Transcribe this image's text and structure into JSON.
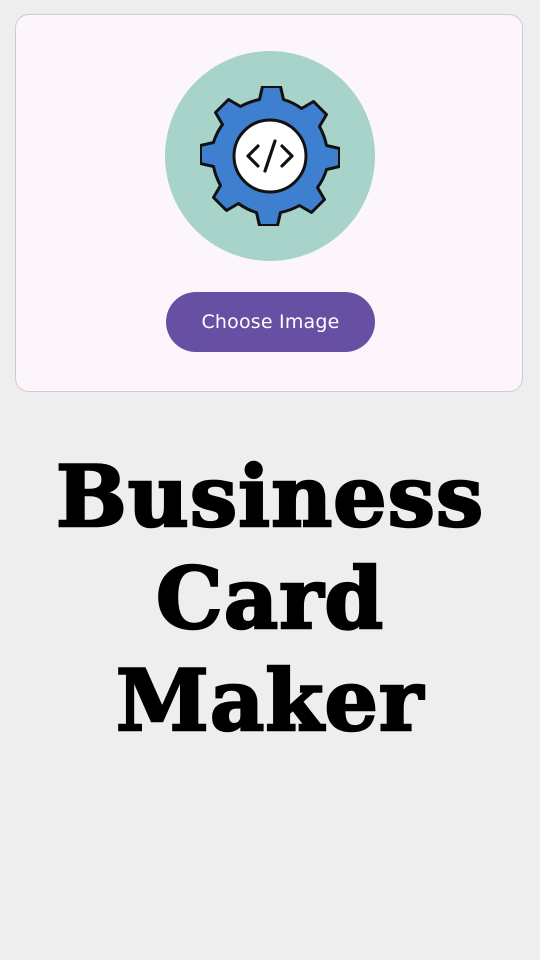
{
  "card": {
    "avatar_icon": "gear-code-icon",
    "choose_image_label": "Choose Image"
  },
  "title": {
    "line1": "Business",
    "line2": "Card",
    "line3": "Maker"
  },
  "colors": {
    "background": "#eeeeee",
    "card_background": "#fcf6fc",
    "avatar_background": "#a8d3cb",
    "gear": "#3f7fcf",
    "button": "#6750a4",
    "button_text": "#ffffff",
    "title": "#000000"
  }
}
